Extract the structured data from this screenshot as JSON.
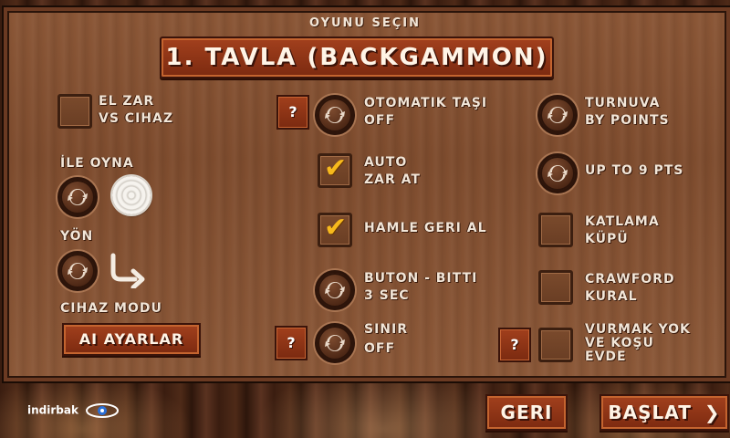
{
  "header": {
    "subtitle": "OYUNU SEÇIN",
    "game_title": "1. TAVLA (BACKGAMMON)"
  },
  "left": {
    "el_zar_line1": "EL ZAR",
    "el_zar_line2": "VS CIHAZ",
    "ile_oyna": "İLE OYNA",
    "yon": "YÖN",
    "cihaz_modu": "CIHAZ MODU",
    "ai_ayarlar": "AI AYARLAR"
  },
  "middle": {
    "q1": "?",
    "otomatik_line1": "OTOMATIK TAŞI",
    "otomatik_line2": "OFF",
    "auto_line1": "AUTO",
    "auto_line2": "ZAR AT",
    "hamle": "HAMLE GERI AL",
    "buton_line1": "BUTON - BITTI",
    "buton_line2": "3 SEC",
    "q2": "?",
    "sinir_line1": "SINIR",
    "sinir_line2": "OFF"
  },
  "right": {
    "turnuva_line1": "TURNUVA",
    "turnuva_line2": "BY POINTS",
    "upto": "UP TO 9 PTS",
    "katlama_line1": "KATLAMA",
    "katlama_line2": "KÜPÜ",
    "crawford_line1": "CRAWFORD",
    "crawford_line2": "KURAL",
    "q3": "?",
    "vurmak_line1": "VURMAK YOK",
    "vurmak_line2": "VE KOŞU",
    "vurmak_line3": "EVDE"
  },
  "footer": {
    "geri": "GERI",
    "baslat": "BAŞLAT",
    "baslat_arrow": "❯",
    "logo_text": "indirbak"
  },
  "checkboxes": {
    "el_zar": false,
    "auto_zar_at": true,
    "hamle_geri_al": true,
    "katlama_kupu": false,
    "crawford_kural": false,
    "vurmak_yok": false
  },
  "checkmark_glyph": "✔",
  "colors": {
    "accent_button": "#a2401d",
    "check": "#f7b91c",
    "text": "#f2e6d8"
  }
}
